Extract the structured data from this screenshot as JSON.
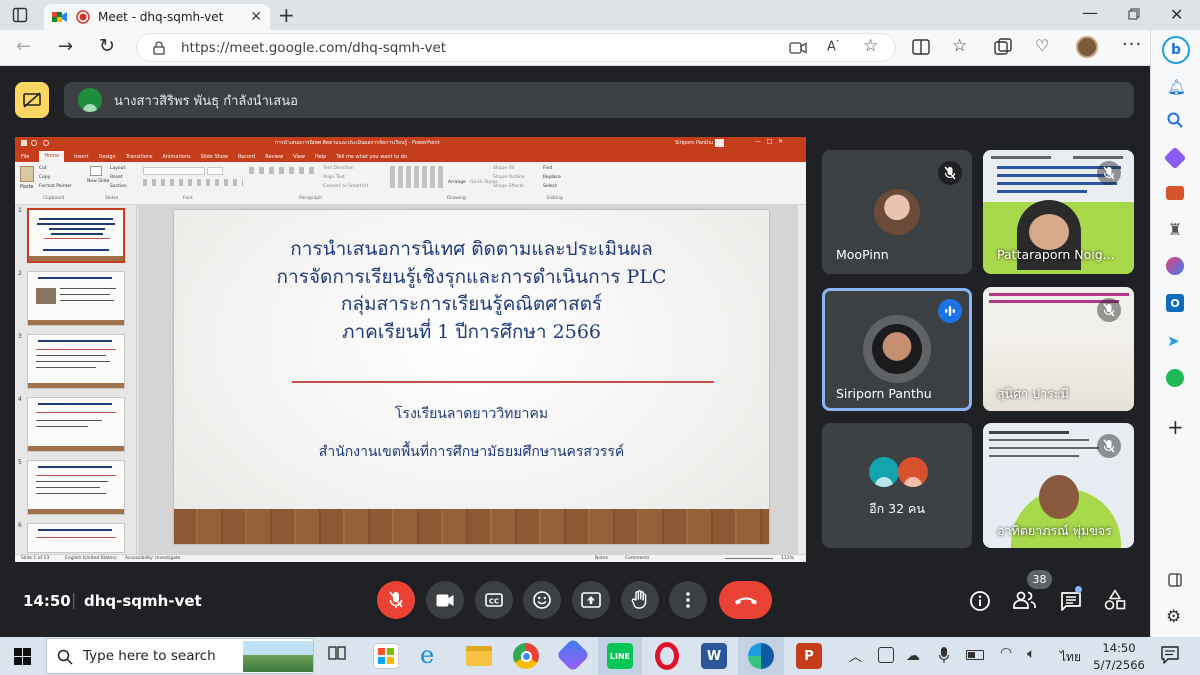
{
  "browser": {
    "tab_title": "Meet - dhq-sqmh-vet",
    "url": "https://meet.google.com/dhq-sqmh-vet"
  },
  "meet": {
    "presenter_banner": "นางสาวสิริพร พันธุ กำลังนำเสนอ",
    "time": "14:50",
    "meeting_code": "dhq-sqmh-vet",
    "participant_count": "38",
    "participants": [
      {
        "name": "MooPinn"
      },
      {
        "name": "Pattaraporn Noig..."
      },
      {
        "name": "Siriporn Panthu"
      },
      {
        "name": "สุนิศา ปาระมี"
      },
      {
        "name": "อีก 32 คน"
      },
      {
        "name": "อาทิตยาภรณ์ พุ่มขจร"
      }
    ]
  },
  "ppt": {
    "window_title": "การนำเสนอการนิเทศ ติดตามและประเมินผลการจัดการเรียนรู้ - PowerPoint",
    "user_name": "Siriporn Panthu",
    "ribbon_tabs": [
      "File",
      "Home",
      "Insert",
      "Design",
      "Transitions",
      "Animations",
      "Slide Show",
      "Record",
      "Review",
      "View",
      "Help",
      "Tell me what you want to do"
    ],
    "groups": [
      "Clipboard",
      "Slides",
      "Font",
      "Paragraph",
      "Drawing",
      "Editing"
    ],
    "clipboard": [
      "Paste",
      "Cut",
      "Copy",
      "Format Painter"
    ],
    "slides_group": [
      "New Slide",
      "Layout",
      "Reset",
      "Section"
    ],
    "paragraph_tools": [
      "Text Direction",
      "Align Text",
      "Convert to SmartArt"
    ],
    "drawing_tools": [
      "Arrange",
      "Quick Styles",
      "Shape Fill",
      "Shape Outline",
      "Shape Effects"
    ],
    "editing_tools": [
      "Find",
      "Replace",
      "Select"
    ],
    "slide_numbers": [
      "1",
      "2",
      "3",
      "4",
      "5",
      "6"
    ],
    "slide": {
      "title_lines": [
        "การนำเสนอการนิเทศ ติดตามและประเมินผล",
        "การจัดการเรียนรู้เชิงรุกและการดำเนินการ PLC",
        "กลุ่มสาระการเรียนรู้คณิตศาสตร์",
        "ภาคเรียนที่ 1 ปีการศึกษา 2566"
      ],
      "school": "โรงเรียนลาดยาววิทยาคม",
      "office": "สำนักงานเขตพื้นที่การศึกษามัธยมศึกษานครสวรรค์"
    },
    "status": {
      "slide_of": "Slide 1 of 13",
      "language": "English (United States)",
      "accessibility": "Accessibility: Investigate",
      "notes": "Notes",
      "comments": "Comments",
      "zoom": "112%"
    }
  },
  "taskbar": {
    "search_placeholder": "Type here to search",
    "app_icons": [
      "task-view",
      "store",
      "edge-legacy",
      "file-explorer",
      "chrome",
      "copilot",
      "line",
      "opera",
      "word",
      "edge",
      "powerpoint"
    ],
    "lang": "ไทย",
    "time": "14:50",
    "date": "5/7/2566"
  },
  "colors": {
    "meet_bg": "#202124",
    "tile_bg": "#3c4043",
    "hangup": "#ea4335",
    "active_border": "#8ab4f8",
    "ppt_orange": "#c43e1c",
    "slide_title": "#1f3b7a",
    "slide_rule": "#c0504d"
  }
}
